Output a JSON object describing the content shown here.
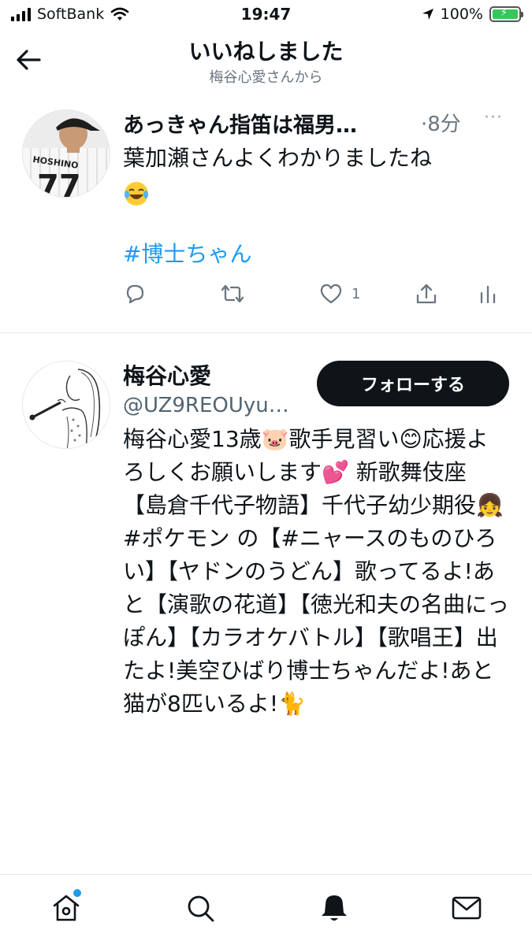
{
  "status_bar": {
    "carrier": "SoftBank",
    "time": "19:47",
    "battery": "100%",
    "battery_level": 1.0
  },
  "header": {
    "title": "いいねしました",
    "subtitle": "梅谷心愛さんから"
  },
  "tweet": {
    "author_name": "あっきゃん指笛は福男…",
    "time": "·8分",
    "more": "···",
    "text": "葉加瀬さんよくわかりましたね",
    "hashtag": "#博士ちゃん",
    "like_count": "1",
    "icons": [
      "reply-icon",
      "retweet-icon",
      "like-icon",
      "share-icon",
      "analytics-icon"
    ]
  },
  "user": {
    "name": "梅谷心愛",
    "handle": "@UZ9REOUyu…",
    "follow_label": "フォローする",
    "bio": "梅谷心愛13歳🐷歌手見習い😊応援よろしくお願いします💕 新歌舞伎座【島倉千代子物語】千代子幼少期役👧 #ポケモン の【#ニャースのものひろい】【ヤドンのうどん】歌ってるよ!あと【演歌の花道】【徳光和夫の名曲にっぽん】【カラオケバトル】【歌唱王】出たよ!美空ひばり博士ちゃんだよ!あと猫が8匹いるよ!🐈"
  },
  "bottom_nav": {
    "items": [
      "home-icon",
      "search-icon",
      "notifications-icon",
      "messages-icon"
    ],
    "accent": "#1d9bf0"
  }
}
